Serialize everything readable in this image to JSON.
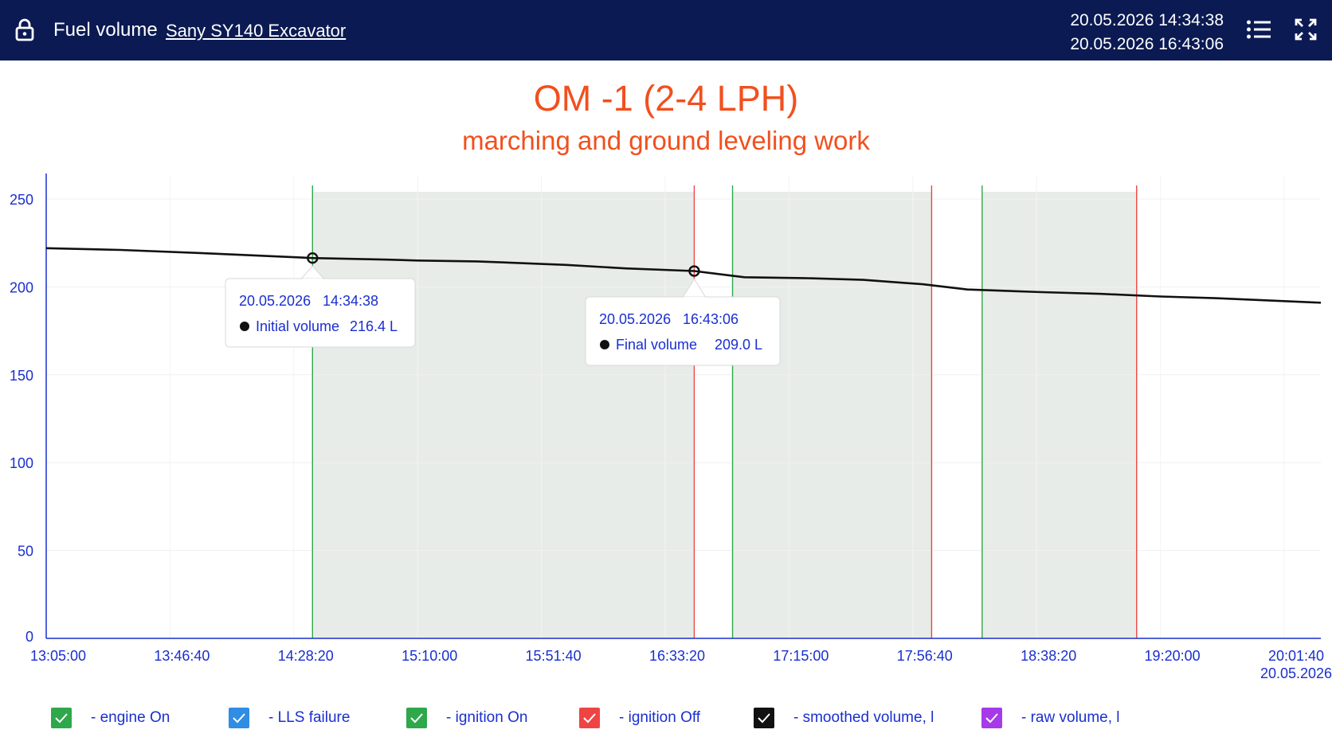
{
  "header": {
    "title": "Fuel volume",
    "vehicle": "Sany SY140 Excavator",
    "date_from": "20.05.2026 14:34:38",
    "date_to": "20.05.2026 16:43:06"
  },
  "colors": {
    "header_bg": "#0b1a52",
    "title": "#f1501e",
    "axis": "#1a2fcf",
    "line": "#111111",
    "shade": "#e8ece8",
    "engine_on": "#2ea84a",
    "lls_failure": "#2f8de4",
    "ignition_on": "#2ea84a",
    "ignition_off": "#ef4444",
    "smoothed": "#111111",
    "raw": "#a63ae8"
  },
  "chart_data": {
    "type": "line",
    "title": "OM -1  (2-4 LPH)",
    "subtitle": "marching and ground leveling work",
    "xlabel": "",
    "ylabel": "",
    "ylim": [
      0,
      250
    ],
    "yticks": [
      "250",
      "200",
      "150",
      "100",
      "50",
      "0"
    ],
    "xlim": [
      "13:05:00",
      "20:14:00"
    ],
    "xticks": [
      "13:05:00",
      "13:46:40",
      "14:28:20",
      "15:10:00",
      "15:51:40",
      "16:33:20",
      "17:15:00",
      "17:56:40",
      "18:38:20",
      "19:20:00",
      "20:01:40"
    ],
    "xtick_date": "20.05.2026",
    "grid": true,
    "series": [
      {
        "name": "smoothed volume, l",
        "x": [
          "13:05:00",
          "13:30:00",
          "14:00:00",
          "14:34:38",
          "15:00:00",
          "15:10:00",
          "15:30:00",
          "16:00:00",
          "16:20:00",
          "16:43:06",
          "17:00:00",
          "17:20:00",
          "17:40:00",
          "18:00:00",
          "18:15:00",
          "18:40:00",
          "19:00:00",
          "19:20:00",
          "19:40:00",
          "20:14:00"
        ],
        "values": [
          222,
          221,
          219,
          216.4,
          215.5,
          215,
          214.5,
          212.5,
          210.5,
          209.0,
          205.5,
          205,
          204,
          201.5,
          198.5,
          197,
          196,
          194.5,
          193.5,
          191
        ]
      }
    ],
    "engine_periods": [
      {
        "on": "14:34:38",
        "off": "16:43:06"
      },
      {
        "on": "16:56:00",
        "off": "18:03:00"
      },
      {
        "on": "18:20:00",
        "off": "19:12:00"
      }
    ],
    "tooltips": [
      {
        "date": "20.05.2026",
        "time": "14:34:38",
        "label": "Initial volume",
        "value": "216.4 L"
      },
      {
        "date": "20.05.2026",
        "time": "16:43:06",
        "label": "Final volume",
        "value": "209.0 L"
      }
    ]
  },
  "legend": [
    {
      "label": "- engine On",
      "color": "#2ea84a"
    },
    {
      "label": "- LLS failure",
      "color": "#2f8de4"
    },
    {
      "label": "- ignition On",
      "color": "#2ea84a"
    },
    {
      "label": "- ignition Off",
      "color": "#ef4444"
    },
    {
      "label": "- smoothed volume, l",
      "color": "#111111"
    },
    {
      "label": "- raw volume, l",
      "color": "#a63ae8"
    }
  ],
  "icons": {
    "lock": "lock-icon",
    "menu": "list-icon",
    "fullscreen": "fullscreen-icon",
    "check": "check-icon"
  }
}
